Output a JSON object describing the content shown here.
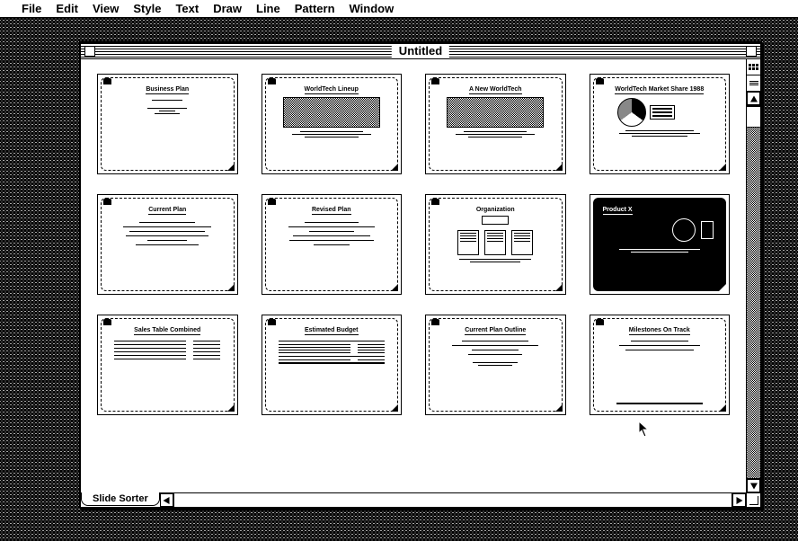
{
  "menubar": {
    "apple": "",
    "items": [
      "File",
      "Edit",
      "View",
      "Style",
      "Text",
      "Draw",
      "Line",
      "Pattern",
      "Window"
    ]
  },
  "window": {
    "title": "Untitled",
    "bottom_tab": "Slide Sorter"
  },
  "slides": [
    {
      "title": "Business Plan",
      "layout": "title",
      "header_right": ""
    },
    {
      "title": "WorldTech Lineup",
      "layout": "map",
      "header_right": ""
    },
    {
      "title": "A New WorldTech",
      "layout": "map",
      "header_right": ""
    },
    {
      "title": "WorldTech Market Share 1988",
      "layout": "pie",
      "header_right": ""
    },
    {
      "title": "Current Plan",
      "layout": "bullets",
      "header_right": ""
    },
    {
      "title": "Revised Plan",
      "layout": "bullets",
      "header_right": ""
    },
    {
      "title": "Organization",
      "layout": "org",
      "header_right": ""
    },
    {
      "title": "Product X",
      "layout": "device",
      "header_right": "",
      "inverted": true
    },
    {
      "title": "Sales Table Combined",
      "layout": "twocol",
      "header_right": ""
    },
    {
      "title": "Estimated Budget",
      "layout": "table",
      "header_right": ""
    },
    {
      "title": "Current Plan Outline",
      "layout": "bullets",
      "header_right": ""
    },
    {
      "title": "Milestones On Track",
      "layout": "footer",
      "header_right": ""
    }
  ]
}
